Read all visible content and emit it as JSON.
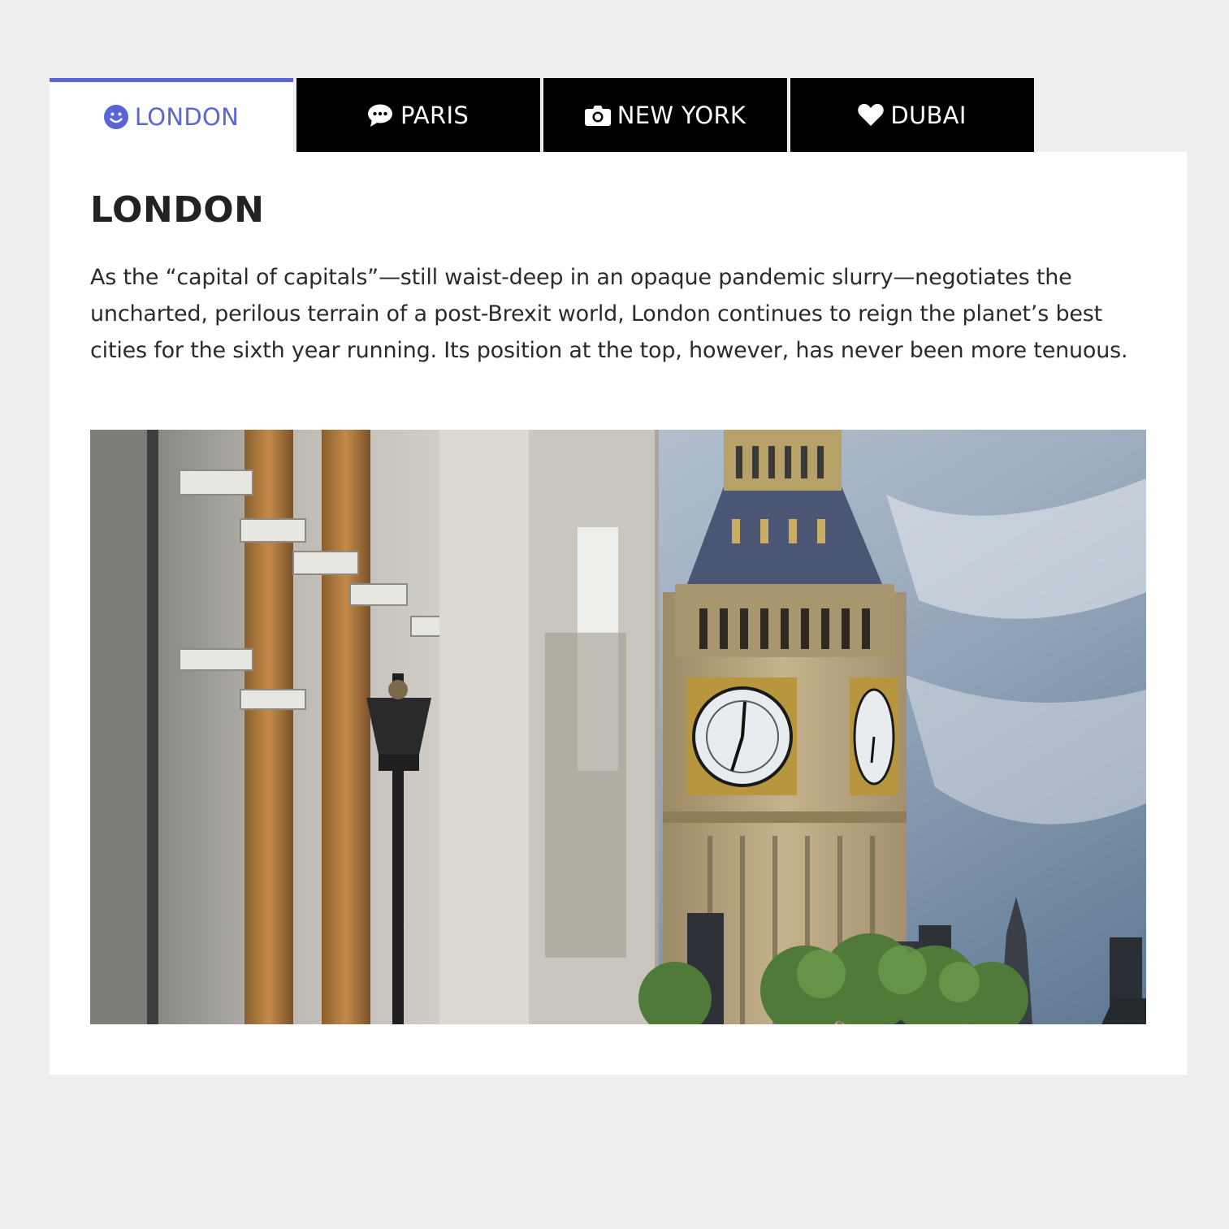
{
  "tabs": [
    {
      "label": "LONDON",
      "icon": "smiley-icon",
      "active": true
    },
    {
      "label": "PARIS",
      "icon": "chat-bubbles-icon",
      "active": false
    },
    {
      "label": "NEW YORK",
      "icon": "camera-icon",
      "active": false
    },
    {
      "label": "DUBAI",
      "icon": "heart-icon",
      "active": false
    }
  ],
  "content": {
    "title": "LONDON",
    "body": "As the “capital of capitals”—still waist-deep in an opaque pandemic slurry—negotiates the uncharted, perilous terrain of a post-Brexit world, London continues to reign the planet’s best cities for the sixth year running. Its position at the top, however, has never been more tenuous."
  },
  "colors": {
    "accent": "#5a66d8",
    "tab_inactive_bg": "#000000",
    "page_bg": "#eeeeee"
  }
}
